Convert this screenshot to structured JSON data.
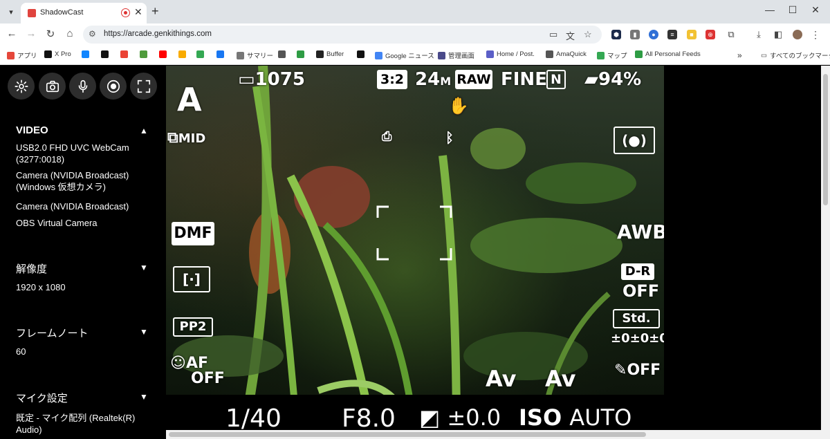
{
  "browser": {
    "tab": {
      "title": "ShadowCast"
    },
    "url": "https://arcade.genkithings.com",
    "bookmarks": [
      {
        "label": "アプリ",
        "color": "#e5473b"
      },
      {
        "label": "X Pro",
        "color": "#111111"
      },
      {
        "label": "",
        "color": "#1185fe"
      },
      {
        "label": "",
        "color": "#111111"
      },
      {
        "label": "",
        "color": "#ea4335"
      },
      {
        "label": "",
        "color": "#4f9b3c"
      },
      {
        "label": "",
        "color": "#ff0000"
      },
      {
        "label": "",
        "color": "#f9ab00"
      },
      {
        "label": "",
        "color": "#34a853"
      },
      {
        "label": "",
        "color": "#1877f2"
      },
      {
        "label": "サマリー",
        "color": "#777777"
      },
      {
        "label": "",
        "color": "#555555"
      },
      {
        "label": "",
        "color": "#2e9c44"
      },
      {
        "label": "Buffer",
        "color": "#222222"
      },
      {
        "label": "",
        "color": "#111111"
      },
      {
        "label": "Google ニュース",
        "color": "#4285f4"
      },
      {
        "label": "管理画面",
        "color": "#4a4a8a"
      },
      {
        "label": "Home / Post.",
        "color": "#5b5fc7"
      },
      {
        "label": "AmaQuick",
        "color": "#555555"
      },
      {
        "label": "マップ",
        "color": "#34a853"
      },
      {
        "label": "All Personal Feeds",
        "color": "#2e9c44"
      }
    ],
    "bookmarks_all": "すべてのブックマーク"
  },
  "sidebar": {
    "video": {
      "title": "VIDEO",
      "items": [
        "USB2.0 FHD UVC WebCam (3277:0018)",
        "Camera (NVIDIA Broadcast) (Windows 仮想カメラ)",
        "Camera (NVIDIA Broadcast)",
        "OBS Virtual Camera"
      ]
    },
    "resolution": {
      "title": "解像度",
      "value": "1920 x 1080"
    },
    "framerate": {
      "title": "フレームノート",
      "value": "60"
    },
    "mic": {
      "title": "マイク設定",
      "value": "既定 - マイク配列 (Realtek(R) Audio)"
    }
  },
  "osd": {
    "mode": "A",
    "battery_shots": "1075",
    "aspect": "3:2",
    "size": "24",
    "size_unit": "M",
    "raw": "RAW",
    "quality": "FINE",
    "nfc": "N",
    "battery_pct": "94%",
    "drive": "MID",
    "dmf": "DMF",
    "pp": "PP2",
    "af": "AF",
    "af_off": "OFF",
    "awb": "AWB",
    "dr": "D-R",
    "dr_off": "OFF",
    "creative": "Std.",
    "creative_vals": "±0±0±0",
    "av1": "Av",
    "av2": "Av",
    "fx_off": "OFF",
    "shutter": "1/40",
    "aperture": "F8.0",
    "exposure": "±0.0",
    "iso": "ISO",
    "iso_value": "AUTO"
  }
}
